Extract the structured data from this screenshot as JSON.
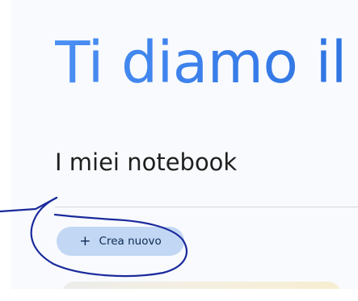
{
  "hero": {
    "title": "Ti diamo il"
  },
  "notebooks": {
    "section_title": "I miei notebook",
    "create_button": {
      "icon": "plus-icon",
      "icon_glyph": "+",
      "label": "Crea nuovo"
    }
  },
  "colors": {
    "hero_gradient_start": "#4b8ff3",
    "hero_gradient_end": "#2f74e2",
    "button_background": "#c2d7f3",
    "annotation_ink": "#1b2a9c"
  }
}
